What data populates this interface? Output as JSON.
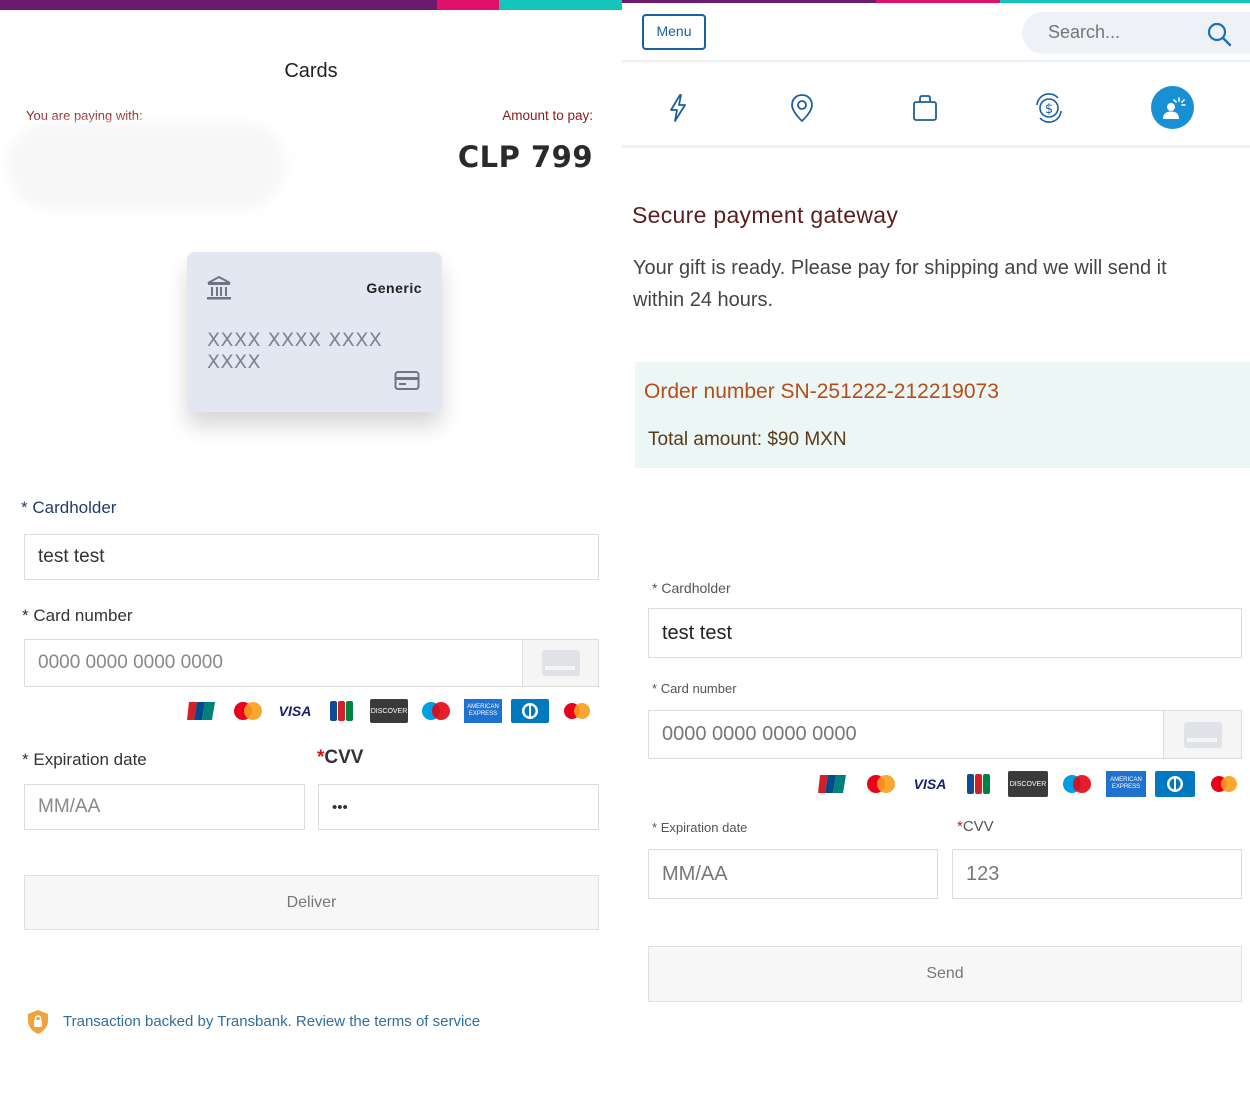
{
  "left": {
    "title": "Cards",
    "paying_with_label": "You are paying with:",
    "amount_label": "Amount to pay:",
    "amount": "CLP 799",
    "card": {
      "brand": "Generic",
      "number": "XXXX XXXX XXXX XXXX"
    },
    "cardholder_label": "Cardholder",
    "cardholder_value": "test test",
    "card_number_label": "Card number",
    "card_number_placeholder": "0000 0000 0000 0000",
    "expiration_label": "Expiration date",
    "expiration_placeholder": "MM/AA",
    "cvv_label": "CVV",
    "cvv_value": "•••",
    "submit_label": "Deliver",
    "footer_text": "Transaction backed by Transbank. Review the terms of service",
    "required_mark": "*"
  },
  "right": {
    "menu_label": "Menu",
    "search_placeholder": "Search...",
    "nav_icons": [
      "bolt-icon",
      "location-pin-icon",
      "shopping-bag-icon",
      "currency-exchange-icon",
      "support-person-icon"
    ],
    "title": "Secure payment gateway",
    "description": "Your gift is ready. Please pay for shipping and we will send it within 24 hours.",
    "order_number": "Order number SN-251222-212219073",
    "total_amount": "Total amount: $90 MXN",
    "cardholder_label": "Cardholder",
    "cardholder_value": "test test",
    "card_number_label": "Card number",
    "card_number_placeholder": "0000 0000 0000 0000",
    "expiration_label": "Expiration date",
    "expiration_placeholder": "MM/AA",
    "cvv_label": "CVV",
    "cvv_placeholder": "123",
    "submit_label": "Send",
    "required_mark": "*"
  },
  "card_brands": [
    "UnionPay",
    "Mastercard",
    "VISA",
    "JCB",
    "DISCOVER",
    "Maestro",
    "AMERICAN EXPRESS",
    "Diners Club",
    "Mastercard"
  ],
  "colors": {
    "topbar_purple": "#6b1a6e",
    "topbar_pink": "#e0106b",
    "topbar_teal": "#14c4b8",
    "accent_blue": "#1890d4",
    "order_box_bg": "#eaf7f4"
  }
}
